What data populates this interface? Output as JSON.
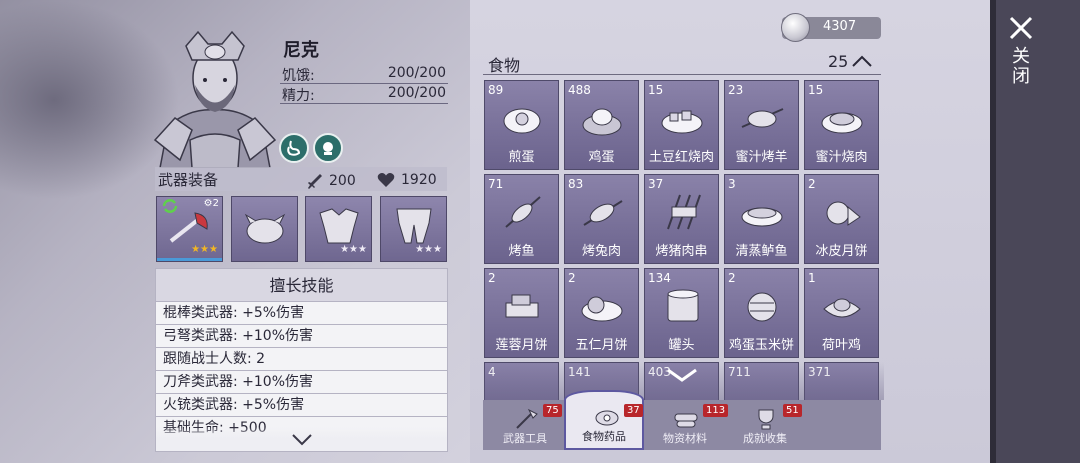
{
  "character": {
    "name": "尼克",
    "hunger_label": "饥饿:",
    "hunger_value": "200/200",
    "energy_label": "精力:",
    "energy_value": "200/200"
  },
  "weapon_section": {
    "title": "武器装备",
    "attack": "200",
    "health": "1920",
    "slots": [
      {
        "icon": "fire-axe-icon",
        "stars": "★★★",
        "level": "2"
      },
      {
        "icon": "boar-mask-icon",
        "stars": ""
      },
      {
        "icon": "armor-icon",
        "stars": "★★★"
      },
      {
        "icon": "leg-armor-icon",
        "stars": "★★★"
      }
    ]
  },
  "skills": {
    "title": "擅长技能",
    "items": [
      "棍棒类武器: +5%伤害",
      "弓弩类武器: +10%伤害",
      "跟随战士人数: 2",
      "刀斧类武器: +10%伤害",
      "火铳类武器: +5%伤害",
      "基础生命: +500"
    ]
  },
  "coins": "4307",
  "food": {
    "title": "食物",
    "count": "25",
    "items": [
      {
        "count": "89",
        "name": "煎蛋"
      },
      {
        "count": "488",
        "name": "鸡蛋"
      },
      {
        "count": "15",
        "name": "土豆红烧肉"
      },
      {
        "count": "23",
        "name": "蜜汁烤羊"
      },
      {
        "count": "15",
        "name": "蜜汁烧肉"
      },
      {
        "count": "71",
        "name": "烤鱼"
      },
      {
        "count": "83",
        "name": "烤兔肉"
      },
      {
        "count": "37",
        "name": "烤猪肉串"
      },
      {
        "count": "3",
        "name": "清蒸鲈鱼"
      },
      {
        "count": "2",
        "name": "冰皮月饼"
      },
      {
        "count": "2",
        "name": "莲蓉月饼"
      },
      {
        "count": "2",
        "name": "五仁月饼"
      },
      {
        "count": "134",
        "name": "罐头"
      },
      {
        "count": "2",
        "name": "鸡蛋玉米饼"
      },
      {
        "count": "1",
        "name": "荷叶鸡"
      },
      {
        "count": "4",
        "name": ""
      },
      {
        "count": "141",
        "name": ""
      },
      {
        "count": "403",
        "name": ""
      },
      {
        "count": "711",
        "name": ""
      },
      {
        "count": "371",
        "name": ""
      }
    ]
  },
  "tabs": [
    {
      "label": "武器工具",
      "badge": "75"
    },
    {
      "label": "食物药品",
      "badge": "37"
    },
    {
      "label": "物资材料",
      "badge": "113"
    },
    {
      "label": "成就收集",
      "badge": "51"
    }
  ],
  "close_label": "关闭",
  "colors": {
    "item_bg": "#7a7299",
    "badge": "#b8262b",
    "active_tab_border": "#5d58a0",
    "status_icon": "#2c6e6a",
    "star_gold": "#f2b623"
  }
}
